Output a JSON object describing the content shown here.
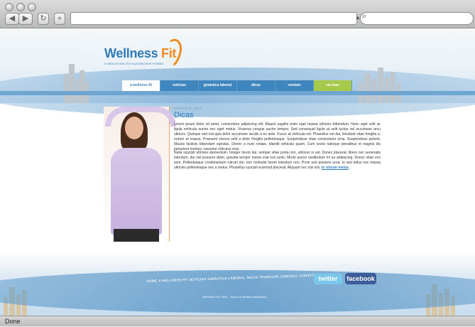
{
  "browser": {
    "back_icon": "back-arrow",
    "forward_icon": "forward-arrow",
    "reload_icon": "reload",
    "add_icon": "plus",
    "search_icon": "magnifier",
    "status_text": "Done"
  },
  "site": {
    "logo_text_1": "Wellness",
    "logo_text_2": "Fit",
    "logo_tagline": "O BEM ESTAR EM SUA MELHOR FORMA",
    "nav": [
      {
        "label": "a wellness fit"
      },
      {
        "label": "notícias"
      },
      {
        "label": "ginástica laboral"
      },
      {
        "label": "dicas"
      },
      {
        "label": "contato"
      },
      {
        "label": "via fone"
      }
    ],
    "breadcrumb": "wellness fit  ›  dicas",
    "page_title": "Dicas",
    "para1": "Lorem ipsum dolor sit amet, consectetur adipiscing elit. Mauris sagittis enim eget massa ultricies bibendum. Nunc eget velit ac ligula vehicula auctor nec eget metus. Vivamus congue auctor tempor. Sed consequat ligula at velit luctus vel accumsan arcu ultrices. Quisque sed nisl quis dolor accumsan iaculis a eu ante. Fusce at vehicula est. Phasellus est dui, tincidunt vitae fringilla a, rutrum at massa. Praesent viverra velit a dolor fringilla pellentesque. Suspendisse vitae consectetur urna. Suspendisse potenti. Mauris facilisis bibendum egestas. Donec a nunc neque, blandit vehicula quam. Cum sociis natoque penatibus et magnis dis parturient montes, nascetur ridiculus mus.",
    "para2": "Nulla suscipit ultricies elementum. Integer lorem dui, semper vitae porta non, ultricies in est. Donec placerat, libero nec venenatis interdum, dui nisl posuere diam, gravida tempor metus erat non justo. Morbi auctor vestibulum mi eu adipiscing. Donec vitae orci sem. Pellentesque condimentum rutrum dui, non molestie lorem interdum non. Proin sed posuere urna. In sed tellus nec massa ultricies pellentesque nec a metus. Phasellus suscipit euismod placerat. Aliquam nec nisi nisi,",
    "para2_link": "in rutrum metus",
    "footer_nav": [
      "Home",
      "A Wellness Fit",
      "Notícias",
      "Ginástica Laboral",
      "Dicas",
      "Trabalhe Conosco",
      "Contato"
    ],
    "copyright": "Wellness Fit © 2011 - Todos os direitos reservados.",
    "twitter_label": "twitter",
    "facebook_label": "facebook"
  }
}
